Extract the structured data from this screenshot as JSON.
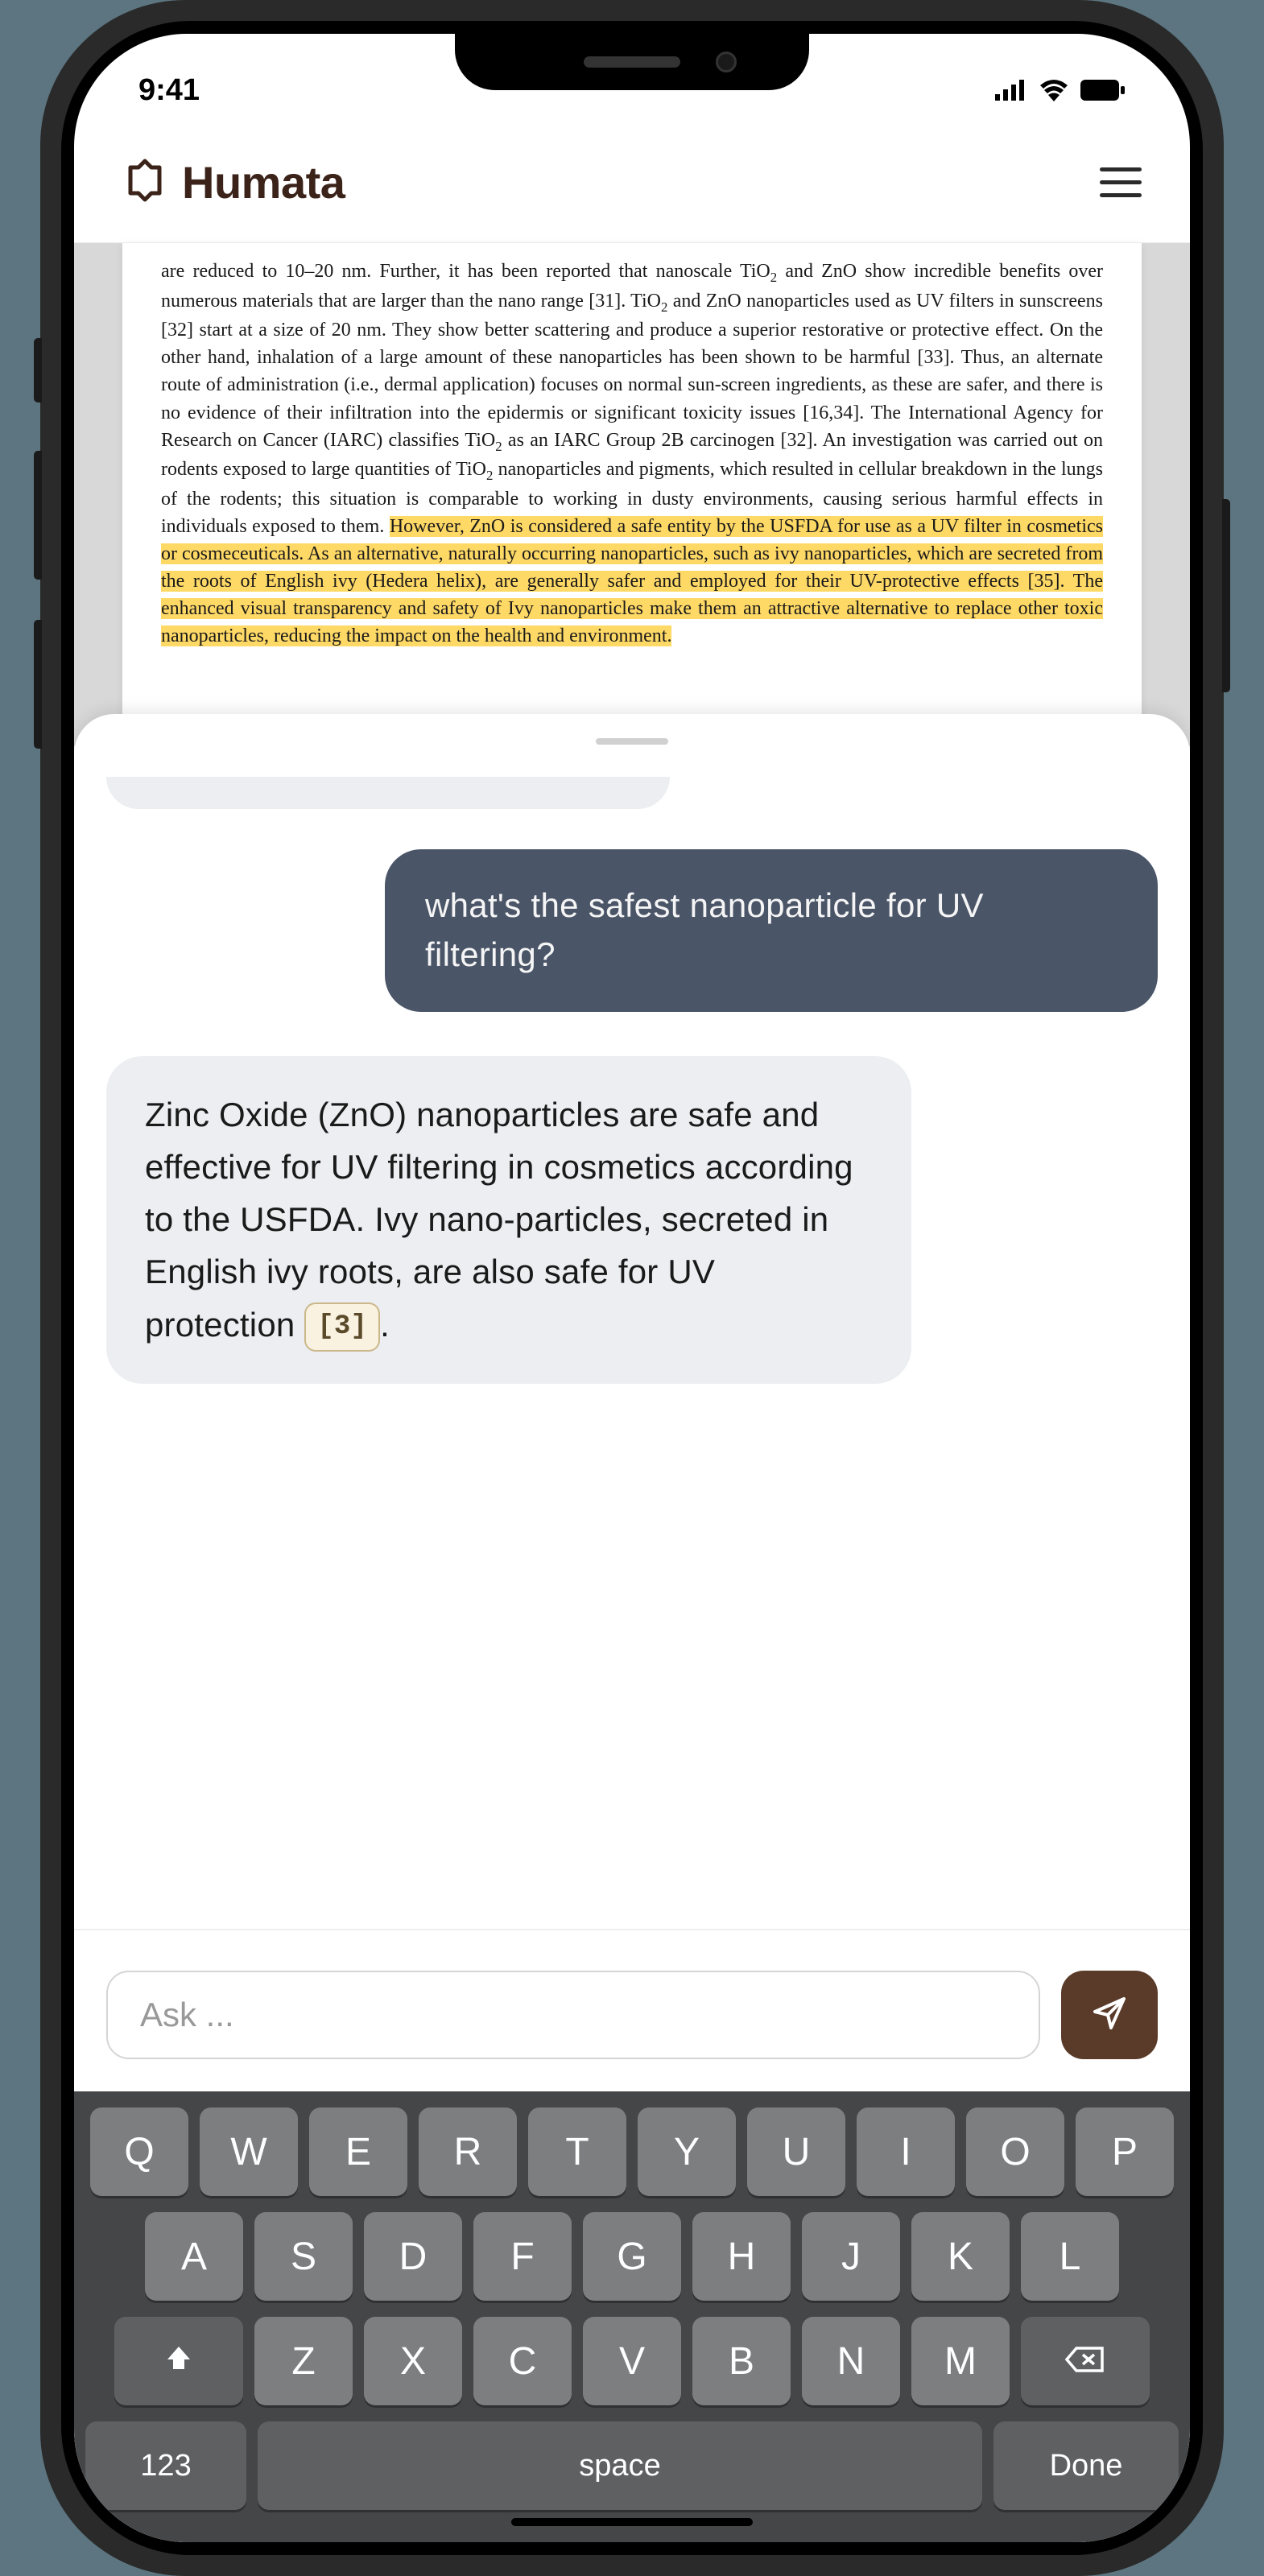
{
  "status": {
    "time": "9:41"
  },
  "header": {
    "brand": "Humata"
  },
  "document": {
    "text_pre": "are reduced to 10–20 nm. Further, it has been reported that nanoscale TiO",
    "text_1": " and ZnO show incredible benefits over numerous materials that are larger than the nano range [31]. TiO",
    "text_2": " and ZnO nanoparticles used as UV filters in sunscreens [32] start at a size of 20 nm. They show better scattering and produce a superior restorative or protective effect. On the other hand, inhalation of a large amount of these nanoparticles has been shown to be harmful [33]. Thus, an alternate route of administration (i.e., dermal application) focuses on normal sun-screen ingredients, as these are safer, and there is no evidence of their infiltration into the epidermis or significant toxicity issues [16,34]. The International Agency for Research on Cancer (IARC) classifies TiO",
    "text_3": " as an IARC Group 2B carcinogen [32]. An investigation was carried out on rodents exposed to large quantities of TiO",
    "text_4": " nanoparticles and pigments, which resulted in cellular breakdown in the lungs of the rodents; this situation is comparable to working in dusty environments, causing serious harmful effects in individuals exposed to them. ",
    "hl": "However, ZnO is considered a safe entity by the USFDA for use as a UV filter in cosmetics or cosmeceuticals. As an alternative, naturally occurring nanoparticles, such as ivy nanoparticles, which are secreted from the roots of English ivy (Hedera helix), are generally safer and employed for their UV-protective effects [35]. The enhanced visual transparency and safety of Ivy nanoparticles make them an attractive alternative to replace other toxic nanoparticles, reducing the impact on the health and environment."
  },
  "chat": {
    "user": "what's the safest nanoparticle for UV filtering?",
    "ai_before": "Zinc Oxide (ZnO) nanoparticles are safe and effective for UV filtering in cosmetics according to the USFDA. Ivy nano-particles, secreted in English ivy roots, are also safe for UV protection ",
    "citation": "[3]",
    "ai_after": "."
  },
  "input": {
    "placeholder": "Ask ..."
  },
  "keyboard": {
    "row1": [
      "Q",
      "W",
      "E",
      "R",
      "T",
      "Y",
      "U",
      "I",
      "O",
      "P"
    ],
    "row2": [
      "A",
      "S",
      "D",
      "F",
      "G",
      "H",
      "J",
      "K",
      "L"
    ],
    "row3": [
      "Z",
      "X",
      "C",
      "V",
      "B",
      "N",
      "M"
    ],
    "numkey": "123",
    "space": "space",
    "done": "Done"
  }
}
